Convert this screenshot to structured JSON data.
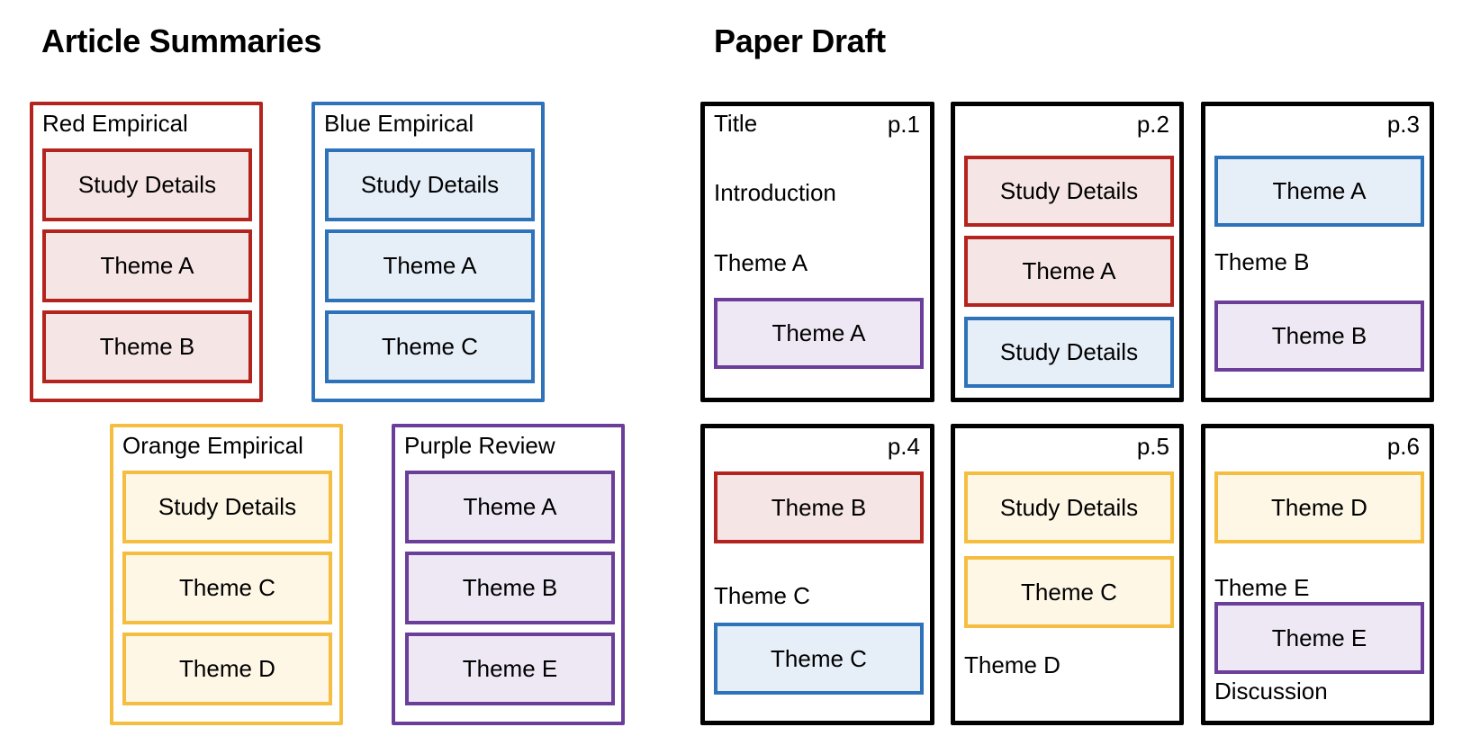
{
  "headings": {
    "left": "Article Summaries",
    "right": "Paper Draft"
  },
  "colors": {
    "red": {
      "border": "#B3241E",
      "fill": "#F6E5E5"
    },
    "blue": {
      "border": "#2E72BA",
      "fill": "#E6EEF8"
    },
    "orange": {
      "border": "#F5BE41",
      "fill": "#FEF7E6"
    },
    "purple": {
      "border": "#6B3E99",
      "fill": "#EEE8F4"
    },
    "page_border": "#000000"
  },
  "articles": [
    {
      "label": "Red Empirical",
      "color": "red",
      "items": [
        "Study Details",
        "Theme A",
        "Theme B"
      ]
    },
    {
      "label": "Blue Empirical",
      "color": "blue",
      "items": [
        "Study Details",
        "Theme A",
        "Theme C"
      ]
    },
    {
      "label": "Orange Empirical",
      "color": "orange",
      "items": [
        "Study Details",
        "Theme C",
        "Theme D"
      ]
    },
    {
      "label": "Purple Review",
      "color": "purple",
      "items": [
        "Theme A",
        "Theme B",
        "Theme E"
      ]
    }
  ],
  "pages": [
    {
      "number": "p.1",
      "heading_text": "Title",
      "texts": [
        "Introduction",
        "Theme A"
      ],
      "chips": [
        {
          "label": "Theme A",
          "color": "purple"
        }
      ]
    },
    {
      "number": "p.2",
      "texts": [],
      "chips": [
        {
          "label": "Study Details",
          "color": "red"
        },
        {
          "label": "Theme A",
          "color": "red"
        },
        {
          "label": "Study Details",
          "color": "blue"
        }
      ]
    },
    {
      "number": "p.3",
      "texts": [
        "Theme B"
      ],
      "chips": [
        {
          "label": "Theme A",
          "color": "blue"
        },
        {
          "label": "Theme B",
          "color": "purple"
        }
      ]
    },
    {
      "number": "p.4",
      "texts": [
        "Theme C"
      ],
      "chips": [
        {
          "label": "Theme B",
          "color": "red"
        },
        {
          "label": "Theme C",
          "color": "blue"
        }
      ]
    },
    {
      "number": "p.5",
      "texts": [
        "Theme D"
      ],
      "chips": [
        {
          "label": "Study Details",
          "color": "orange"
        },
        {
          "label": "Theme C",
          "color": "orange"
        }
      ]
    },
    {
      "number": "p.6",
      "texts": [
        "Theme E",
        "Discussion"
      ],
      "chips": [
        {
          "label": "Theme D",
          "color": "orange"
        },
        {
          "label": "Theme E",
          "color": "purple"
        }
      ]
    }
  ]
}
